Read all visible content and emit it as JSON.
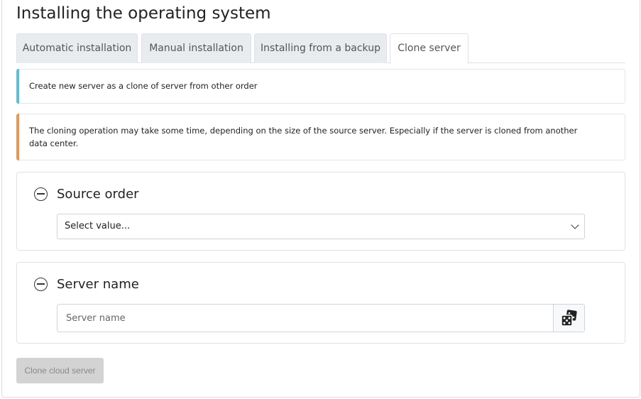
{
  "page": {
    "title": "Installing the operating system"
  },
  "tabs": [
    {
      "label": "Automatic installation",
      "active": false
    },
    {
      "label": "Manual installation",
      "active": false
    },
    {
      "label": "Installing from a backup",
      "active": false
    },
    {
      "label": "Clone server",
      "active": true
    }
  ],
  "alerts": {
    "info": "Create new server as a clone of server from other order",
    "warning": "The cloning operation may take some time, depending on the size of the source server. Especially if the server is cloned from another data center."
  },
  "source_order": {
    "title": "Source order",
    "select_value": "Select value..."
  },
  "server_name": {
    "title": "Server name",
    "placeholder": "Server name",
    "value": ""
  },
  "actions": {
    "clone_label": "Clone cloud server"
  },
  "icons": {
    "collapse": "minus-circle-icon",
    "dropdown": "chevron-down-icon",
    "random": "dice-icon"
  },
  "colors": {
    "info_accent": "#5bc0de",
    "warning_accent": "#f0954f",
    "tab_inactive_bg": "#e9ecef",
    "disabled_button_bg": "#d3d3d3"
  }
}
